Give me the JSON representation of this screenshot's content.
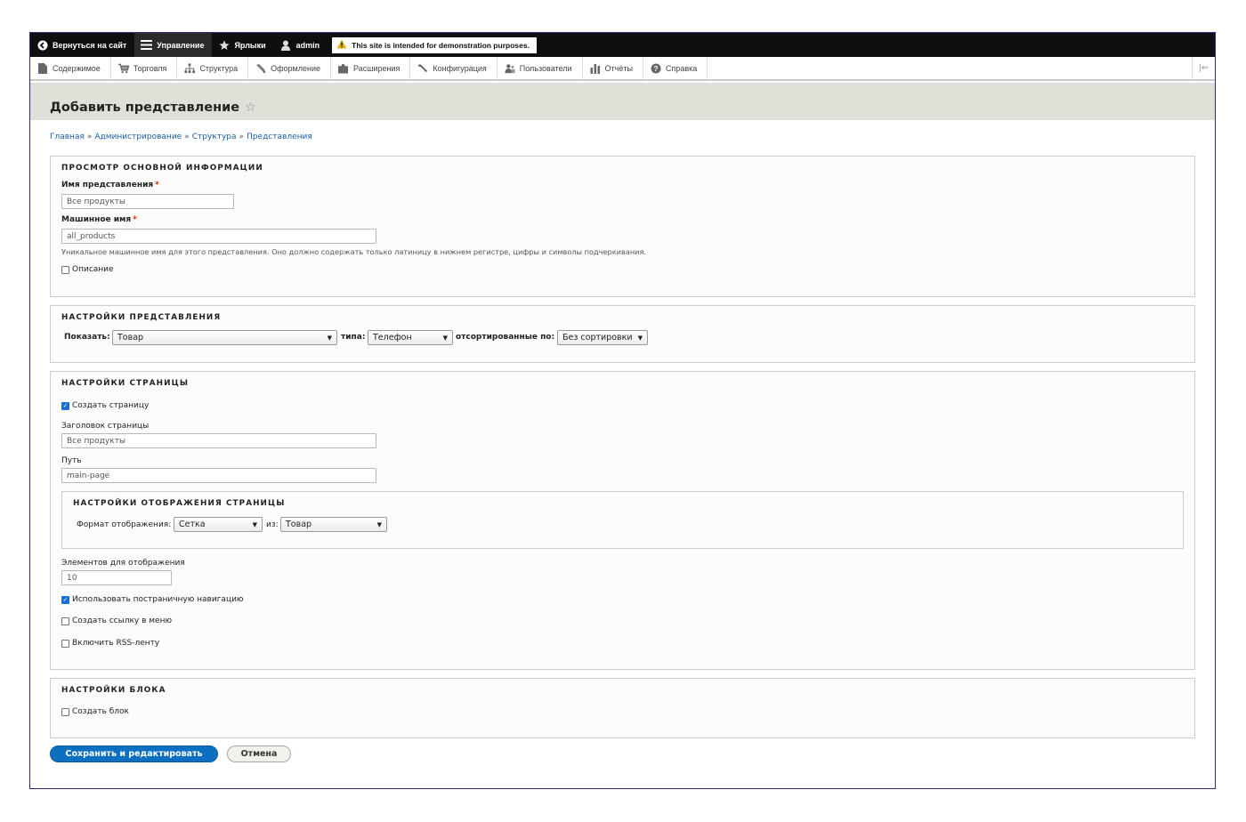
{
  "toolbar": {
    "back_label": "Вернуться на сайт",
    "manage_label": "Управление",
    "shortcuts_label": "Ярлыки",
    "user_label": "admin",
    "demo_message": "This site is intended for demonstration purposes."
  },
  "tray": {
    "items": [
      {
        "label": "Содержимое",
        "icon": "document-icon"
      },
      {
        "label": "Торговля",
        "icon": "cart-icon"
      },
      {
        "label": "Структура",
        "icon": "sitemap-icon"
      },
      {
        "label": "Оформление",
        "icon": "brush-icon"
      },
      {
        "label": "Расширения",
        "icon": "puzzle-icon"
      },
      {
        "label": "Конфигурация",
        "icon": "wrench-icon"
      },
      {
        "label": "Пользователи",
        "icon": "people-icon"
      },
      {
        "label": "Отчёты",
        "icon": "bar-chart-icon"
      },
      {
        "label": "Справка",
        "icon": "help-icon"
      }
    ]
  },
  "page": {
    "title": "Добавить представление"
  },
  "breadcrumb": [
    "Главная",
    "Администрирование",
    "Структура",
    "Представления"
  ],
  "basic": {
    "title": "Просмотр основной информации",
    "view_name_label": "Имя представления",
    "view_name_value": "Все продукты",
    "machine_name_label": "Машинное имя",
    "machine_name_value": "all_products",
    "machine_name_desc": "Уникальное машинное имя для этого представления. Оно должно содержать только латиницу в нижнем регистре, цифры и символы подчеркивания.",
    "description_label": "Описание"
  },
  "view_settings": {
    "title": "Настройки представления",
    "show_label": "Показать:",
    "show_value": "Товар",
    "type_label": "типа:",
    "type_value": "Телефон",
    "sorted_label": "отсортированные по:",
    "sorted_value": "Без сортировки"
  },
  "page_settings": {
    "title": "Настройки страницы",
    "create_page_label": "Создать страницу",
    "create_page_checked": true,
    "page_title_label": "Заголовок страницы",
    "page_title_value": "Все продукты",
    "path_label": "Путь",
    "path_value": "main-page",
    "display": {
      "title": "Настройки отображения страницы",
      "format_label": "Формат отображения:",
      "format_value": "Сетка",
      "of_label": "из:",
      "of_value": "Товар"
    },
    "items_label": "Элементов для отображения",
    "items_value": "10",
    "pager_label": "Использовать постраничную навигацию",
    "pager_checked": true,
    "menu_link_label": "Создать ссылку в меню",
    "menu_link_checked": false,
    "rss_label": "Включить RSS-ленту",
    "rss_checked": false
  },
  "block_settings": {
    "title": "Настройки блока",
    "create_block_label": "Создать блок",
    "create_block_checked": false
  },
  "actions": {
    "save_label": "Сохранить и редактировать",
    "cancel_label": "Отмена"
  },
  "colors": {
    "accent": "#0c6fc0",
    "toolbar_bg": "#0f0f0f",
    "required": "#e32700",
    "link": "#1a5fa8"
  }
}
